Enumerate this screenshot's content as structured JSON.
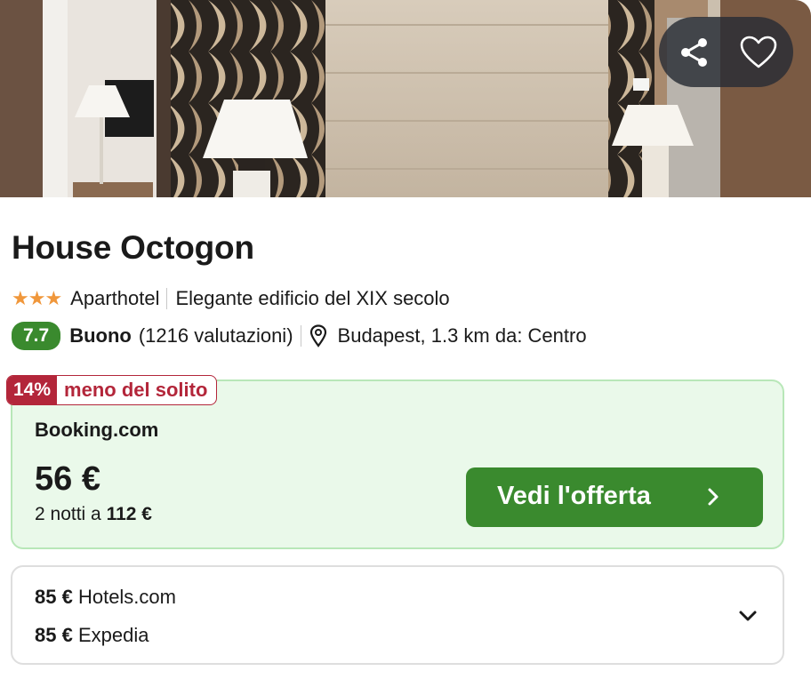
{
  "hotel": {
    "name": "House Octogon",
    "stars": "★★★",
    "type": "Aparthotel",
    "feature": "Elegante edificio del XIX secolo",
    "rating_score": "7.7",
    "rating_label": "Buono",
    "rating_count": "(1216 valutazioni)",
    "location": "Budapest, 1.3 km da: Centro"
  },
  "deal": {
    "discount_pct": "14%",
    "discount_text": "meno del solito",
    "provider": "Booking.com",
    "price": "56 €",
    "nights_prefix": "2 notti a ",
    "nights_total": "112 €",
    "cta_label": "Vedi l'offerta"
  },
  "other_offers": [
    {
      "price": "85 €",
      "provider": "Hotels.com"
    },
    {
      "price": "85 €",
      "provider": "Expedia"
    }
  ],
  "icons": {
    "share": "share-icon",
    "favorite": "heart-icon",
    "location": "map-pin-icon",
    "cta": "chevron-right-icon",
    "expand": "chevron-down-icon"
  },
  "colors": {
    "accent_green": "#3a8a2e",
    "deal_bg": "#eaf9ea",
    "discount_red": "#b3263a",
    "star_orange": "#f0973b"
  }
}
